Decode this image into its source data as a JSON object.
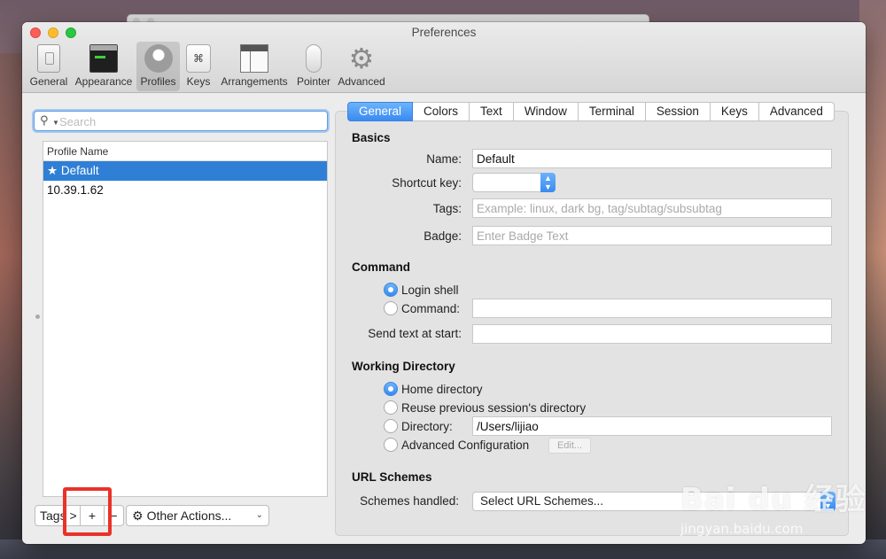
{
  "window": {
    "title": "Preferences"
  },
  "toolbar": {
    "items": [
      {
        "label": "General",
        "icon": "general-switch-icon"
      },
      {
        "label": "Appearance",
        "icon": "appearance-terminal-icon"
      },
      {
        "label": "Profiles",
        "icon": "profiles-person-icon",
        "selected": true
      },
      {
        "label": "Keys",
        "icon": "keys-command-icon",
        "glyph": "⌘"
      },
      {
        "label": "Arrangements",
        "icon": "arrangements-window-icon"
      },
      {
        "label": "Pointer",
        "icon": "pointer-mouse-icon"
      },
      {
        "label": "Advanced",
        "icon": "advanced-gear-icon",
        "glyph": "⚙"
      }
    ]
  },
  "sidebar": {
    "search": {
      "placeholder": "Search",
      "value": ""
    },
    "list_header": "Profile Name",
    "profiles": [
      {
        "name": "★ Default",
        "selected": true
      },
      {
        "name": "10.39.1.62",
        "selected": false
      }
    ],
    "bottom": {
      "tags": "Tags >",
      "add": "+",
      "remove": "−",
      "other_actions": "Other Actions...",
      "gear": "⚙",
      "chevron": "⌄"
    }
  },
  "tabs": [
    "General",
    "Colors",
    "Text",
    "Window",
    "Terminal",
    "Session",
    "Keys",
    "Advanced"
  ],
  "general": {
    "basics": {
      "heading": "Basics",
      "name_label": "Name:",
      "name_value": "Default",
      "shortcut_label": "Shortcut key:",
      "tags_label": "Tags:",
      "tags_placeholder": "Example: linux, dark bg, tag/subtag/subsubtag",
      "badge_label": "Badge:",
      "badge_placeholder": "Enter Badge Text"
    },
    "command": {
      "heading": "Command",
      "login_shell": "Login shell",
      "command_label": "Command:",
      "send_text_label": "Send text at start:"
    },
    "working_directory": {
      "heading": "Working Directory",
      "home": "Home directory",
      "reuse": "Reuse previous session's directory",
      "directory_label": "Directory:",
      "directory_value": "/Users/lijiao",
      "advanced_config": "Advanced Configuration",
      "edit": "Edit..."
    },
    "url_schemes": {
      "heading": "URL Schemes",
      "schemes_label": "Schemes handled:",
      "select_value": "Select URL Schemes..."
    }
  },
  "watermark": {
    "brand": "Bai du 经验",
    "sub": "jingyan.baidu.com"
  },
  "colors": {
    "accent": "#3a8af2",
    "highlight": "#e9322a",
    "selection": "#2f7fd6"
  }
}
